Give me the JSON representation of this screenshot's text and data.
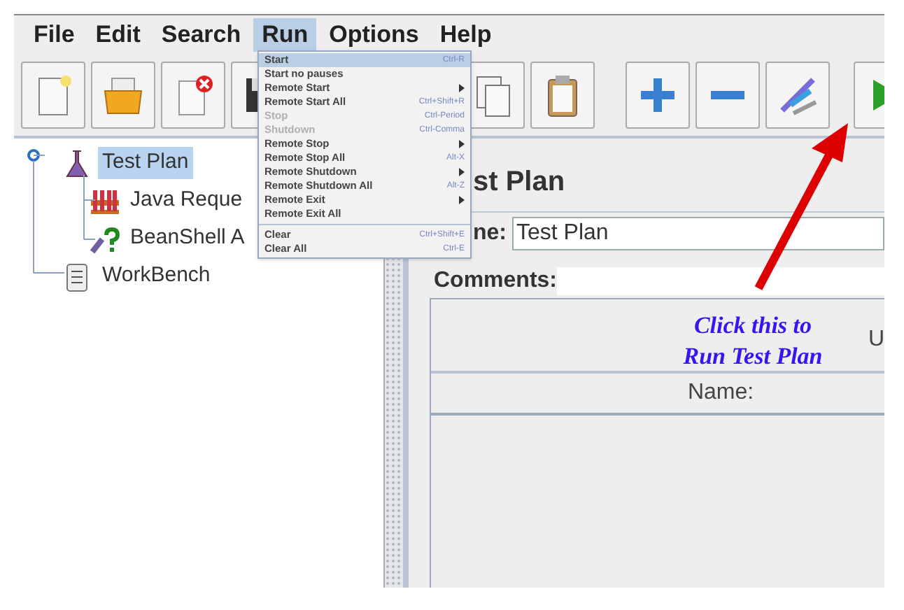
{
  "menu_bar": [
    {
      "label": "File",
      "selected": false
    },
    {
      "label": "Edit",
      "selected": false
    },
    {
      "label": "Search",
      "selected": false
    },
    {
      "label": "Run",
      "selected": true
    },
    {
      "label": "Options",
      "selected": false
    },
    {
      "label": "Help",
      "selected": false
    }
  ],
  "run_menu": [
    {
      "kind": "item",
      "label": "Start",
      "shortcut": "Ctrl-R",
      "selected": true,
      "disabled": false,
      "submenu": false
    },
    {
      "kind": "item",
      "label": "Start no pauses",
      "selected": false,
      "disabled": false,
      "submenu": false
    },
    {
      "kind": "item",
      "label": "Remote Start",
      "selected": false,
      "disabled": false,
      "submenu": true
    },
    {
      "kind": "item",
      "label": "Remote Start All",
      "shortcut": "Ctrl+Shift+R",
      "selected": false,
      "disabled": false,
      "submenu": false
    },
    {
      "kind": "item",
      "label": "Stop",
      "shortcut": "Ctrl-Period",
      "selected": false,
      "disabled": true,
      "submenu": false
    },
    {
      "kind": "item",
      "label": "Shutdown",
      "shortcut": "Ctrl-Comma",
      "selected": false,
      "disabled": true,
      "submenu": false
    },
    {
      "kind": "item",
      "label": "Remote Stop",
      "selected": false,
      "disabled": false,
      "submenu": true
    },
    {
      "kind": "item",
      "label": "Remote Stop All",
      "shortcut": "Alt-X",
      "selected": false,
      "disabled": false,
      "submenu": false
    },
    {
      "kind": "item",
      "label": "Remote Shutdown",
      "selected": false,
      "disabled": false,
      "submenu": true
    },
    {
      "kind": "item",
      "label": "Remote Shutdown All",
      "shortcut": "Alt-Z",
      "selected": false,
      "disabled": false,
      "submenu": false
    },
    {
      "kind": "item",
      "label": "Remote Exit",
      "selected": false,
      "disabled": false,
      "submenu": true
    },
    {
      "kind": "item",
      "label": "Remote Exit All",
      "selected": false,
      "disabled": false,
      "submenu": false
    },
    {
      "kind": "separator"
    },
    {
      "kind": "item",
      "label": "Clear",
      "shortcut": "Ctrl+Shift+E",
      "selected": false,
      "disabled": false,
      "submenu": false
    },
    {
      "kind": "item",
      "label": "Clear All",
      "shortcut": "Ctrl-E",
      "selected": false,
      "disabled": false,
      "submenu": false
    }
  ],
  "tree": [
    {
      "label": "Test Plan",
      "kind": "plan",
      "selected": true,
      "expanded": true,
      "children": [
        {
          "label": "Java Reque",
          "kind": "sampler",
          "selected": false
        },
        {
          "label": "BeanShell A",
          "kind": "assertion",
          "selected": false
        }
      ]
    },
    {
      "label": "WorkBench",
      "kind": "workbench",
      "selected": false
    }
  ],
  "panel": {
    "title": "st Plan",
    "name_label": "ne:",
    "name_value": "Test Plan",
    "comments_label": "Comments:",
    "table_header": "U",
    "table_column": "Name:"
  },
  "annotation": {
    "lines": [
      "Click this to",
      "Run Test Plan"
    ]
  }
}
